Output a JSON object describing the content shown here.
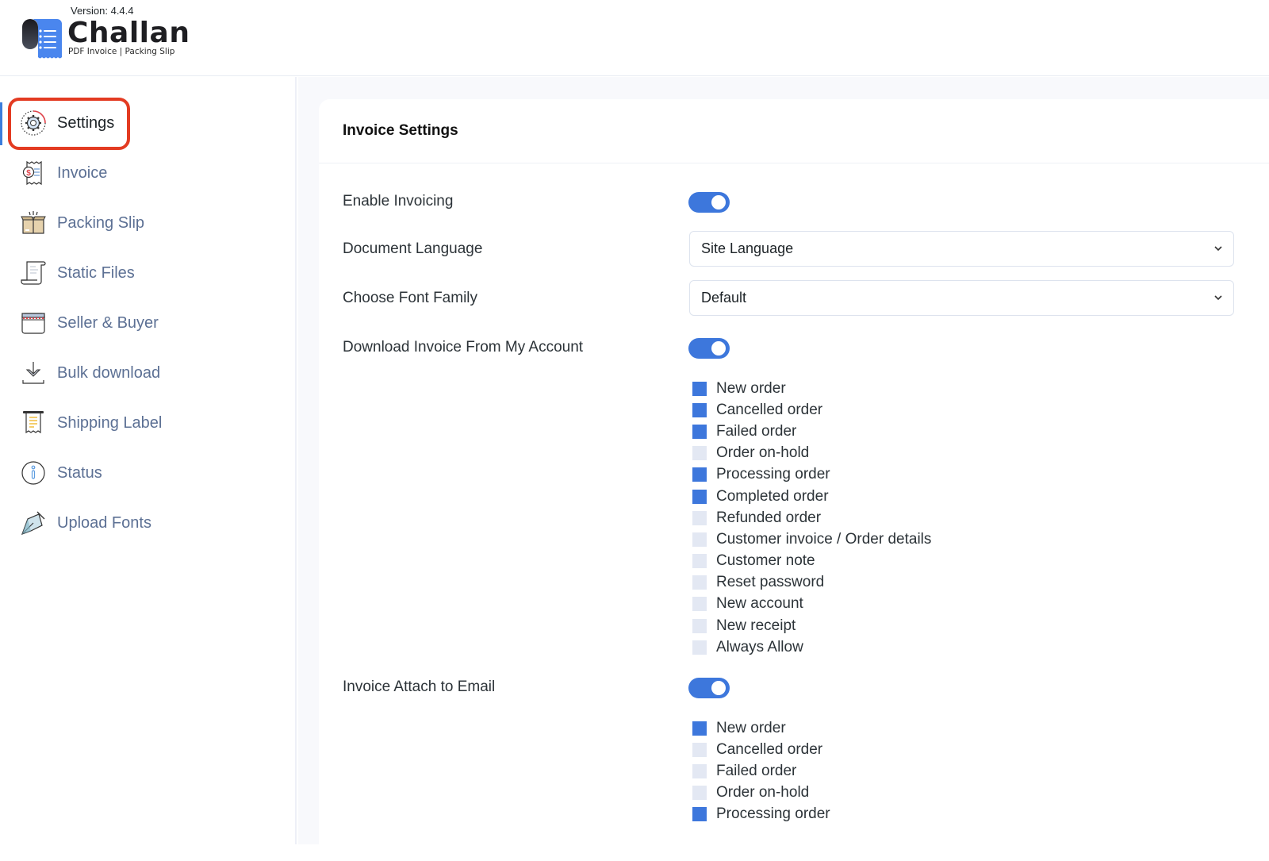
{
  "header": {
    "version": "Version: 4.4.4",
    "logo_title": "Challan",
    "logo_subtitle": "PDF Invoice | Packing Slip"
  },
  "colors": {
    "accent": "#3d77dc",
    "highlight_outline": "#e33b22",
    "nav_text": "#5c7094"
  },
  "sidebar": {
    "items": [
      {
        "label": "Settings",
        "icon": "gear-icon",
        "active": true
      },
      {
        "label": "Invoice",
        "icon": "invoice-receipt-icon",
        "active": false
      },
      {
        "label": "Packing Slip",
        "icon": "open-box-icon",
        "active": false
      },
      {
        "label": "Static Files",
        "icon": "scroll-document-icon",
        "active": false
      },
      {
        "label": "Seller & Buyer",
        "icon": "storefront-icon",
        "active": false
      },
      {
        "label": "Bulk download",
        "icon": "download-tray-icon",
        "active": false
      },
      {
        "label": "Shipping Label",
        "icon": "shipping-label-icon",
        "active": false
      },
      {
        "label": "Status",
        "icon": "info-circle-icon",
        "active": false
      },
      {
        "label": "Upload Fonts",
        "icon": "pen-nib-icon",
        "active": false
      }
    ]
  },
  "main": {
    "card_title": "Invoice Settings",
    "enable_invoicing": {
      "label": "Enable Invoicing",
      "on": true
    },
    "document_language": {
      "label": "Document Language",
      "value": "Site Language"
    },
    "font_family": {
      "label": "Choose Font Family",
      "value": "Default"
    },
    "download_from_account": {
      "label": "Download Invoice From My Account",
      "on": true,
      "options": [
        {
          "label": "New order",
          "checked": true
        },
        {
          "label": "Cancelled order",
          "checked": true
        },
        {
          "label": "Failed order",
          "checked": true
        },
        {
          "label": "Order on-hold",
          "checked": false
        },
        {
          "label": "Processing order",
          "checked": true
        },
        {
          "label": "Completed order",
          "checked": true
        },
        {
          "label": "Refunded order",
          "checked": false
        },
        {
          "label": "Customer invoice / Order details",
          "checked": false
        },
        {
          "label": "Customer note",
          "checked": false
        },
        {
          "label": "Reset password",
          "checked": false
        },
        {
          "label": "New account",
          "checked": false
        },
        {
          "label": "New receipt",
          "checked": false
        },
        {
          "label": "Always Allow",
          "checked": false
        }
      ]
    },
    "attach_to_email": {
      "label": "Invoice Attach to Email",
      "on": true,
      "options": [
        {
          "label": "New order",
          "checked": true
        },
        {
          "label": "Cancelled order",
          "checked": false
        },
        {
          "label": "Failed order",
          "checked": false
        },
        {
          "label": "Order on-hold",
          "checked": false
        },
        {
          "label": "Processing order",
          "checked": true
        }
      ]
    }
  }
}
